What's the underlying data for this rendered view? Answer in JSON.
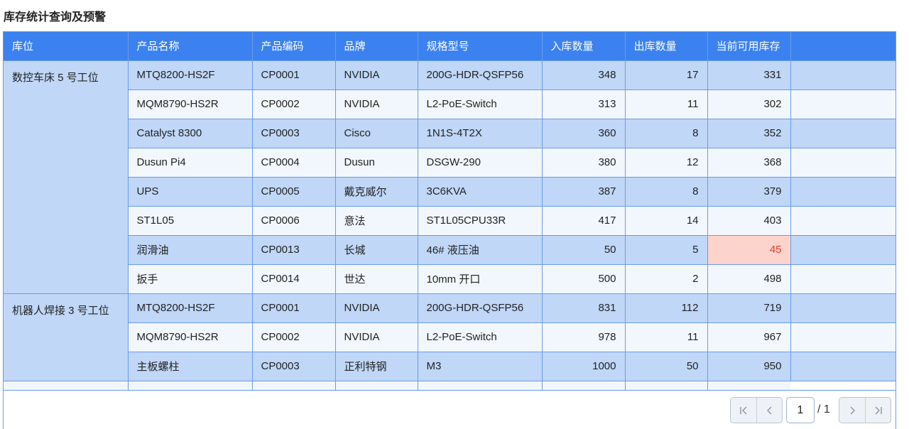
{
  "page": {
    "title": "库存统计查询及预警"
  },
  "table": {
    "columns": [
      "库位",
      "产品名称",
      "产品编码",
      "品牌",
      "规格型号",
      "入库数量",
      "出库数量",
      "当前可用库存"
    ],
    "groups": [
      {
        "location": "数控车床 5 号工位"
      },
      {
        "location": "机器人焊接 3 号工位"
      }
    ],
    "rows": [
      {
        "name": "MTQ8200-HS2F",
        "code": "CP0001",
        "brand": "NVIDIA",
        "spec": "200G-HDR-QSFP56",
        "in": "348",
        "out": "17",
        "avail": "331"
      },
      {
        "name": "MQM8790-HS2R",
        "code": "CP0002",
        "brand": "NVIDIA",
        "spec": "L2-PoE-Switch",
        "in": "313",
        "out": "11",
        "avail": "302"
      },
      {
        "name": "Catalyst 8300",
        "code": "CP0003",
        "brand": "Cisco",
        "spec": "1N1S-4T2X",
        "in": "360",
        "out": "8",
        "avail": "352"
      },
      {
        "name": "Dusun Pi4",
        "code": "CP0004",
        "brand": "Dusun",
        "spec": "DSGW-290",
        "in": "380",
        "out": "12",
        "avail": "368"
      },
      {
        "name": "UPS",
        "code": "CP0005",
        "brand": "戴克威尔",
        "spec": "3C6KVA",
        "in": "387",
        "out": "8",
        "avail": "379"
      },
      {
        "name": "ST1L05",
        "code": "CP0006",
        "brand": "意法",
        "spec": "ST1L05CPU33R",
        "in": "417",
        "out": "14",
        "avail": "403"
      },
      {
        "name": "润滑油",
        "code": "CP0013",
        "brand": "长城",
        "spec": "46# 液压油",
        "in": "50",
        "out": "5",
        "avail": "45",
        "warning": true
      },
      {
        "name": "扳手",
        "code": "CP0014",
        "brand": "世达",
        "spec": "10mm 开口",
        "in": "500",
        "out": "2",
        "avail": "498"
      },
      {
        "name": "MTQ8200-HS2F",
        "code": "CP0001",
        "brand": "NVIDIA",
        "spec": "200G-HDR-QSFP56",
        "in": "831",
        "out": "112",
        "avail": "719"
      },
      {
        "name": "MQM8790-HS2R",
        "code": "CP0002",
        "brand": "NVIDIA",
        "spec": "L2-PoE-Switch",
        "in": "978",
        "out": "11",
        "avail": "967"
      },
      {
        "name": "主板螺柱",
        "code": "CP0003",
        "brand": "正利特钢",
        "spec": "M3",
        "in": "1000",
        "out": "50",
        "avail": "950"
      }
    ],
    "warning_colors": {
      "background": "#fcd4cc",
      "text": "#e03a2c"
    }
  },
  "pager": {
    "current_page": "1",
    "total_label": "/ 1",
    "icons": [
      "first-page-icon",
      "prev-page-icon",
      "next-page-icon",
      "last-page-icon"
    ]
  }
}
